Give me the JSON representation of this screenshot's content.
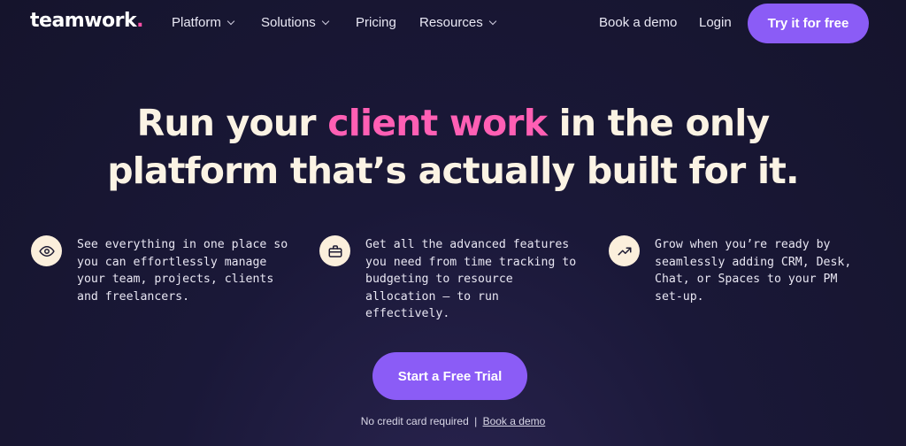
{
  "header": {
    "logo_text": "teamwork",
    "logo_dot": ".",
    "logo_dot_color": "#ff4fa6",
    "nav": [
      {
        "label": "Platform",
        "has_dropdown": true
      },
      {
        "label": "Solutions",
        "has_dropdown": true
      },
      {
        "label": "Pricing",
        "has_dropdown": false
      },
      {
        "label": "Resources",
        "has_dropdown": true
      }
    ],
    "book_demo": "Book a demo",
    "login": "Login",
    "try_free": "Try it for free"
  },
  "hero": {
    "headline_pre": "Run your ",
    "headline_accent": "client work",
    "headline_post": " in the only",
    "headline_line2": "platform that’s actually built for it.",
    "accent_color": "#ff5fb4"
  },
  "features": [
    {
      "icon": "eye-icon",
      "text": "See everything in one place so you can effortlessly manage your team, projects, clients and freelancers."
    },
    {
      "icon": "briefcase-icon",
      "text": "Get all the advanced features you need from time tracking to budgeting to resource allocation — to run effectively."
    },
    {
      "icon": "trending-up-icon",
      "text": "Grow when you’re ready by seamlessly adding CRM, Desk, Chat, or Spaces to your PM set-up."
    }
  ],
  "cta": {
    "label": "Start a Free Trial",
    "note_text": "No credit card required",
    "note_separator": "|",
    "note_link": "Book a demo"
  },
  "colors": {
    "button": "#8b5cf6",
    "background": "#1a1838",
    "headline": "#fbf3e4",
    "icon_bg": "#fbefdc"
  }
}
